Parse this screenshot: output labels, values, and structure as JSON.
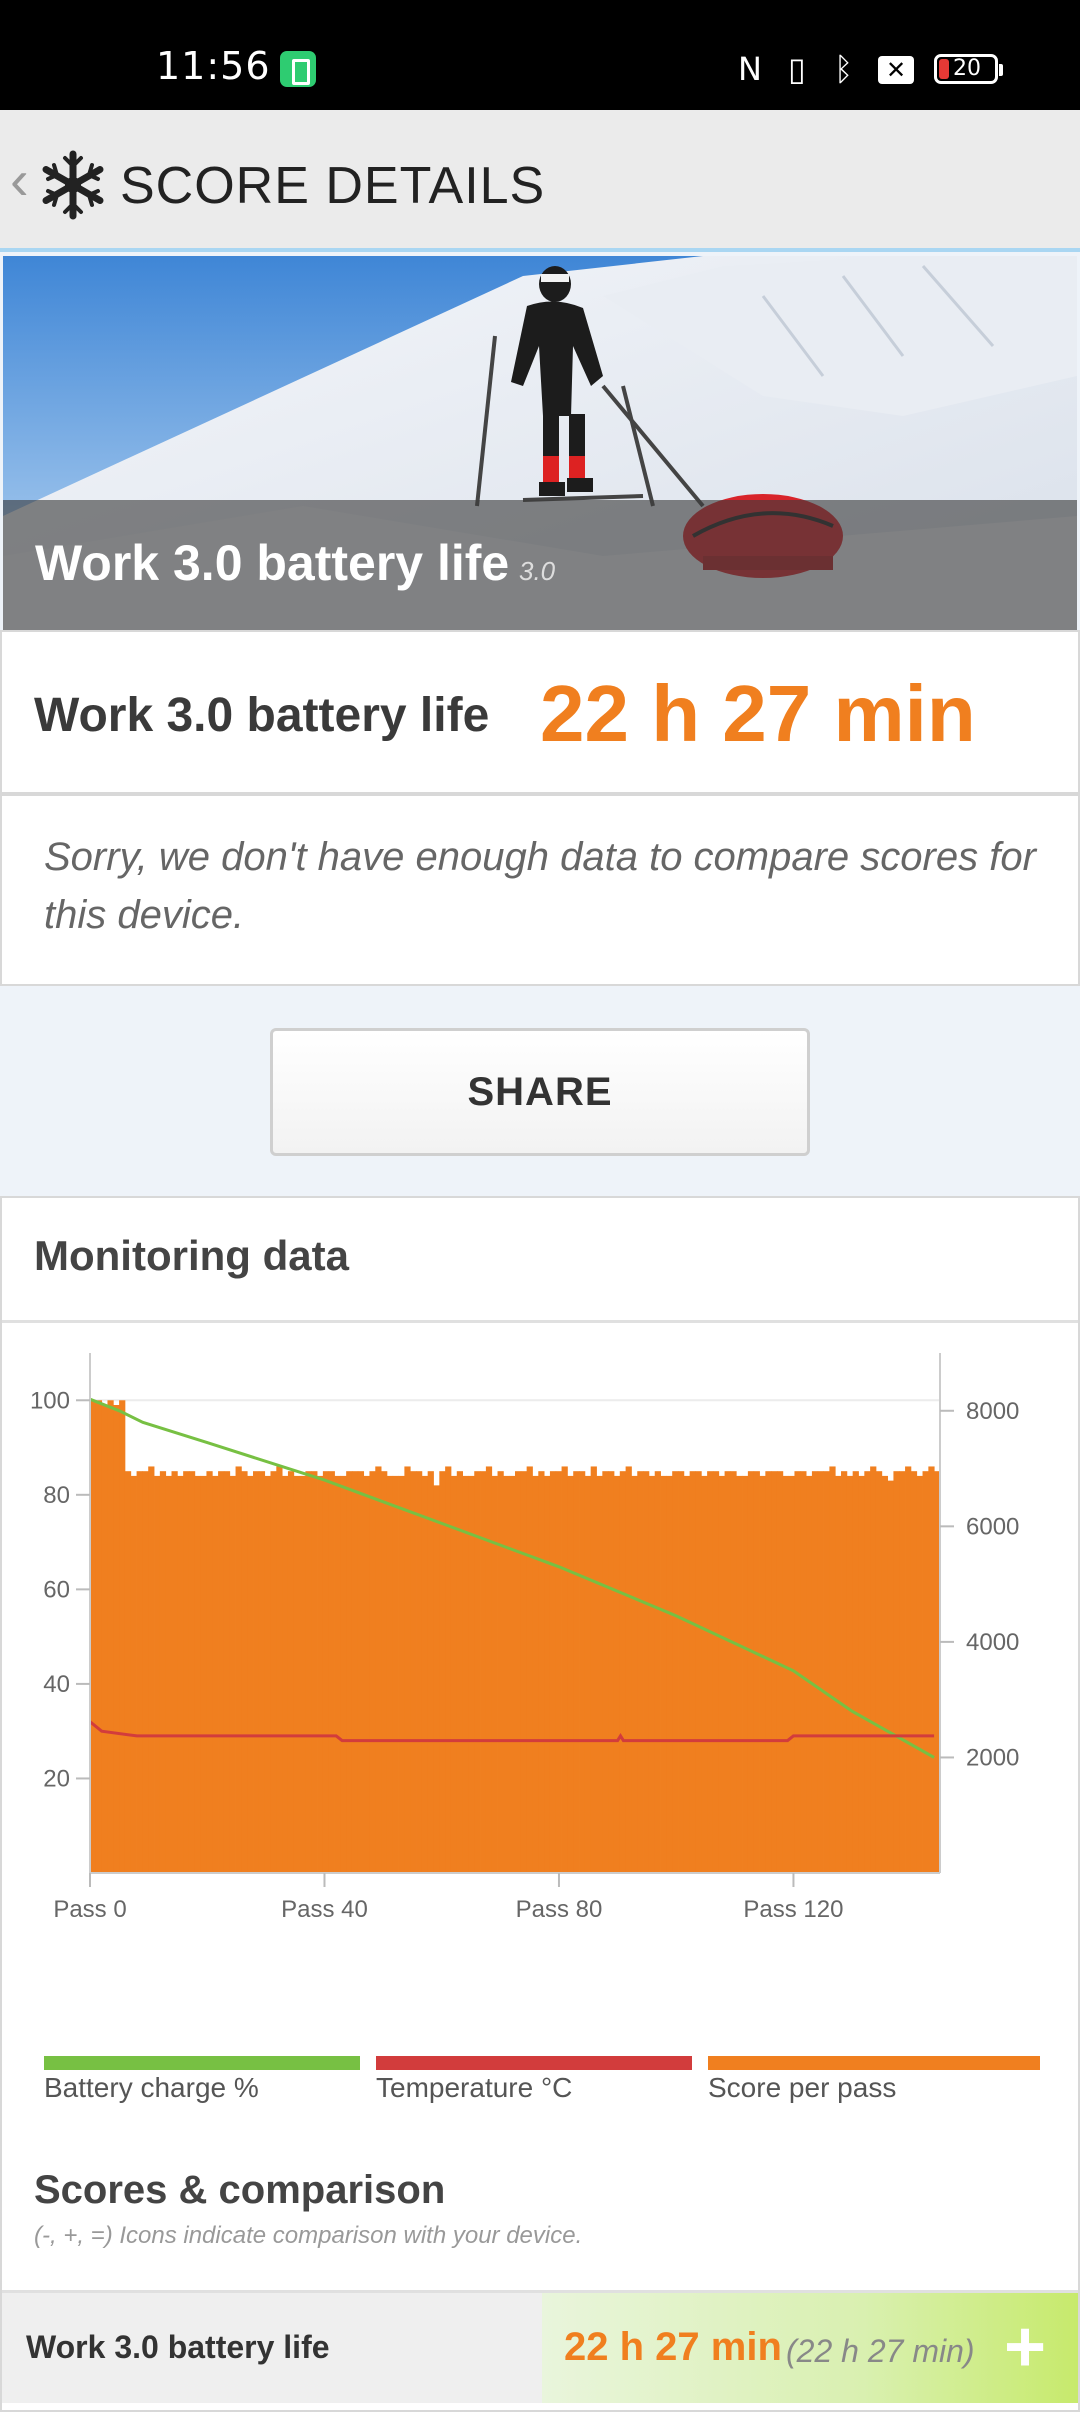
{
  "status_bar": {
    "time": "11:56",
    "battery_level": "20"
  },
  "app_bar": {
    "back_glyph": "‹",
    "title": "SCORE DETAILS"
  },
  "hero": {
    "title": "Work 3.0 battery life",
    "version": "3.0"
  },
  "score": {
    "label": "Work 3.0 battery life",
    "value": "22 h 27 min"
  },
  "note": "Sorry, we don't have enough data to compare scores for this device.",
  "share_label": "SHARE",
  "monitoring": {
    "title": "Monitoring data",
    "legend": [
      {
        "label": "Battery charge %",
        "color": "#77c043"
      },
      {
        "label": "Temperature °C",
        "color": "#d23c3c"
      },
      {
        "label": "Score per pass",
        "color": "#f07f1f"
      }
    ]
  },
  "chart_data": {
    "type": "bar",
    "x_ticks": [
      "Pass 0",
      "Pass 40",
      "Pass 80",
      "Pass 120"
    ],
    "x_range": [
      0,
      145
    ],
    "y_left_ticks": [
      20,
      40,
      60,
      80,
      100
    ],
    "y_left_range": [
      0,
      110
    ],
    "y_right_ticks": [
      2000,
      4000,
      6000,
      8000
    ],
    "y_right_range": [
      0,
      9000
    ],
    "grid": false,
    "legend_position": "bottom",
    "series": [
      {
        "name": "Score per pass",
        "axis": "left",
        "values": [
          100,
          100,
          99,
          100,
          99,
          100,
          85,
          84,
          85,
          85,
          86,
          84,
          85,
          84,
          85,
          84,
          85,
          85,
          84,
          84,
          85,
          84,
          85,
          85,
          84,
          86,
          85,
          84,
          85,
          85,
          84,
          85,
          86,
          84,
          85,
          84,
          84,
          85,
          85,
          84,
          85,
          85,
          84,
          84,
          85,
          85,
          85,
          84,
          85,
          86,
          85,
          84,
          84,
          84,
          86,
          85,
          85,
          84,
          85,
          82,
          85,
          86,
          84,
          85,
          84,
          84,
          85,
          85,
          86,
          84,
          85,
          84,
          84,
          85,
          85,
          86,
          84,
          85,
          84,
          85,
          85,
          86,
          84,
          85,
          85,
          84,
          86,
          84,
          85,
          85,
          84,
          85,
          86,
          84,
          85,
          85,
          84,
          85,
          84,
          84,
          85,
          85,
          84,
          85,
          85,
          84,
          85,
          85,
          84,
          85,
          85,
          84,
          84,
          85,
          85,
          84,
          85,
          85,
          85,
          84,
          84,
          85,
          85,
          84,
          85,
          85,
          85,
          86,
          84,
          85,
          84,
          85,
          84,
          85,
          86,
          85,
          84,
          83,
          85,
          85,
          86,
          85,
          84,
          85,
          86,
          85
        ]
      },
      {
        "name": "Battery charge %",
        "axis": "right",
        "points": [
          [
            0,
            8200
          ],
          [
            5,
            8000
          ],
          [
            9,
            7800
          ],
          [
            20,
            7450
          ],
          [
            40,
            6800
          ],
          [
            60,
            6050
          ],
          [
            80,
            5300
          ],
          [
            100,
            4450
          ],
          [
            120,
            3500
          ],
          [
            130,
            2800
          ],
          [
            144,
            2000
          ]
        ]
      },
      {
        "name": "Temperature °C",
        "axis": "left",
        "points": [
          [
            0,
            32
          ],
          [
            2,
            30
          ],
          [
            8,
            29
          ],
          [
            42,
            29
          ],
          [
            43,
            28
          ],
          [
            90,
            28
          ],
          [
            90.5,
            29
          ],
          [
            91,
            28
          ],
          [
            119,
            28
          ],
          [
            120,
            29
          ],
          [
            144,
            29
          ]
        ]
      }
    ]
  },
  "scores": {
    "title": "Scores & comparison",
    "hint": "(-, +, =) Icons indicate comparison with your device.",
    "row": {
      "label": "Work 3.0 battery life",
      "value": "22 h 27 min",
      "reference": "(22 h 27 min)",
      "indicator": "+"
    }
  }
}
